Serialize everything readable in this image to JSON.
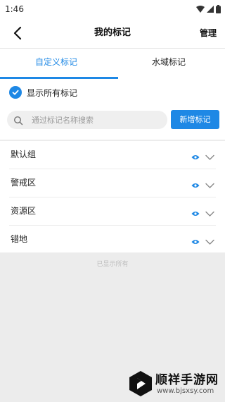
{
  "status_bar": {
    "time": "1:46"
  },
  "nav": {
    "title": "我的标记",
    "manage_label": "管理"
  },
  "tabs": [
    {
      "label": "自定义标记",
      "active": true
    },
    {
      "label": "水域标记",
      "active": false
    }
  ],
  "show_all": {
    "label": "显示所有标记",
    "checked": true
  },
  "search": {
    "placeholder": "通过标记名称搜索",
    "value": ""
  },
  "add_button": {
    "label": "新增标记"
  },
  "groups": [
    {
      "label": "默认组",
      "visible": true
    },
    {
      "label": "警戒区",
      "visible": true
    },
    {
      "label": "资源区",
      "visible": true
    },
    {
      "label": "错地",
      "visible": true
    }
  ],
  "footer_note": "已显示所有",
  "watermark": {
    "title": "顺祥手游网",
    "url": "www.bjsxsy.com"
  },
  "colors": {
    "accent": "#1e88e5",
    "background": "#ececec",
    "surface": "#ffffff"
  }
}
